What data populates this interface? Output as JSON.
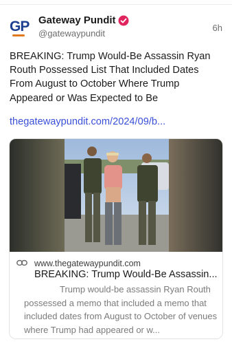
{
  "post": {
    "author_name": "Gateway Pundit",
    "author_handle": "@gatewaypundit",
    "avatar_text": "GP",
    "time": "6h",
    "text": "BREAKING: Trump Would-Be Assassin Ryan Routh Possessed List That Included Dates From August to October Where Trump Appeared or Was Expected to Be",
    "link_text": "thegatewaypundit.com/2024/09/b..."
  },
  "link_card": {
    "domain": "www.thegatewaypundit.com",
    "title": "BREAKING: Trump Would-Be Assassin...",
    "description": "Trump would-be assassin Ryan Routh possessed a memo that included a memo that included dates from August to October of venues where Trump had appeared or w..."
  },
  "colors": {
    "link": "#3a4fd8",
    "verified_badge": "#e0245e",
    "avatar_primary": "#1d3f8f",
    "avatar_accent": "#e0791e"
  },
  "icons": {
    "verified": "verified-badge-icon",
    "link": "link-icon"
  }
}
